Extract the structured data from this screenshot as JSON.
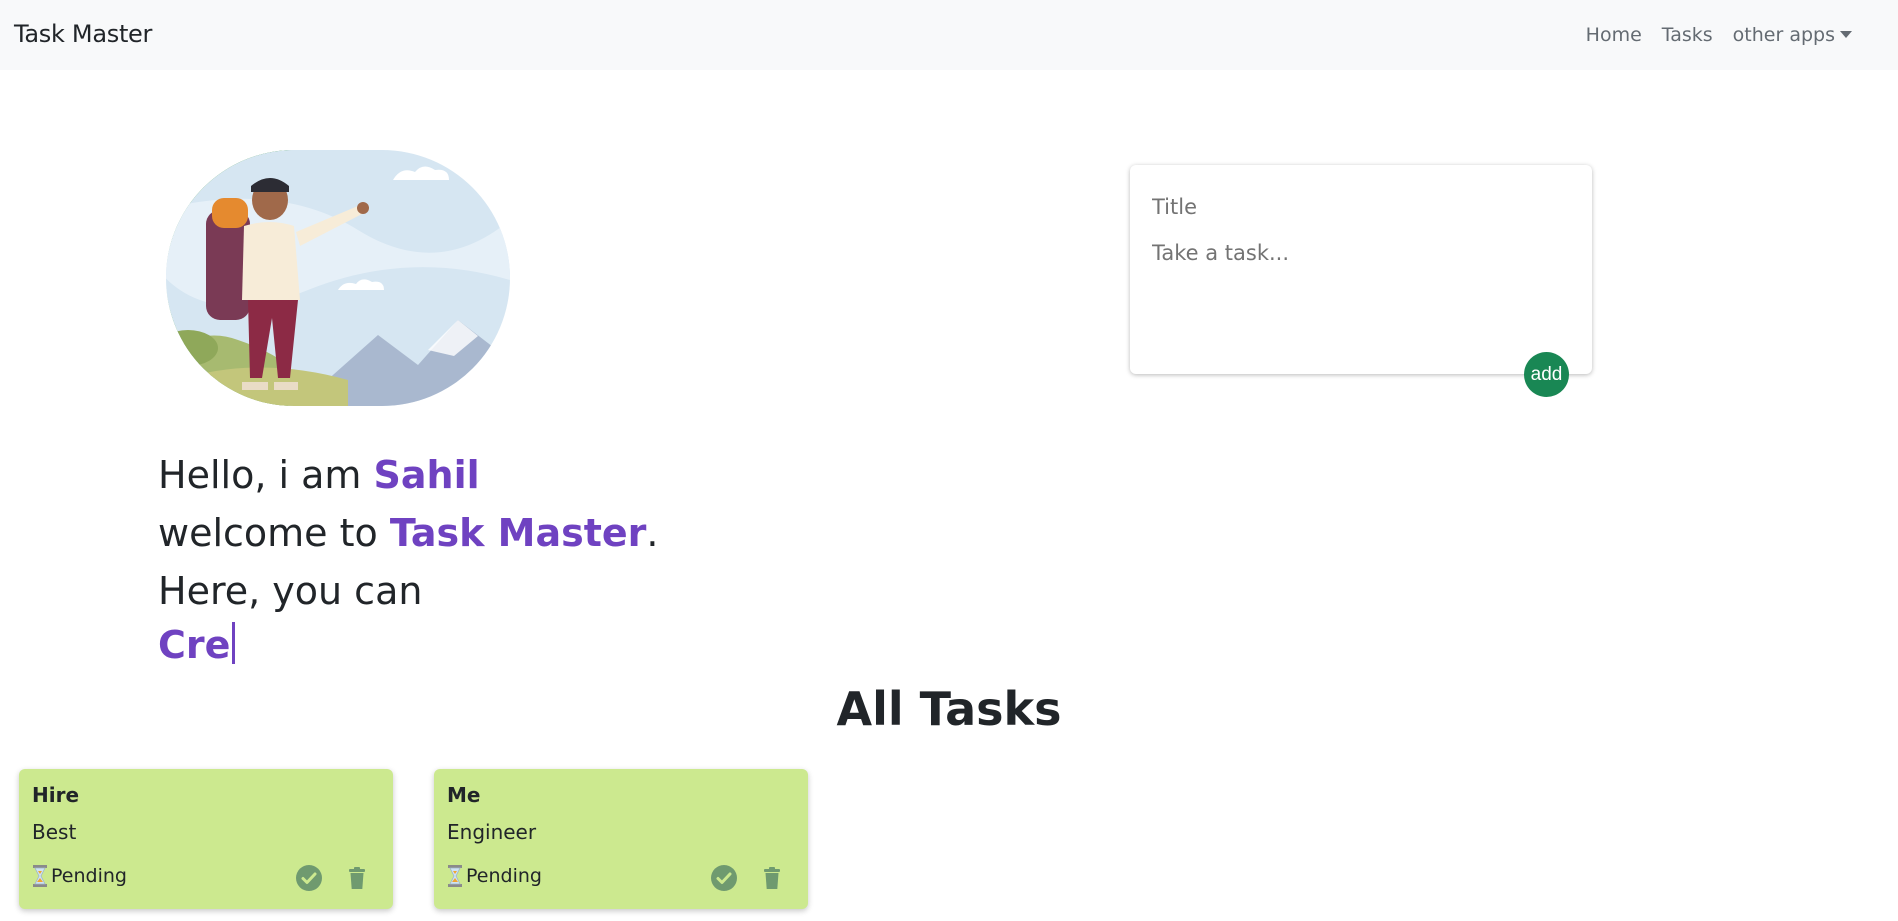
{
  "navbar": {
    "brand": "Task Master",
    "links": [
      {
        "label": "Home"
      },
      {
        "label": "Tasks"
      },
      {
        "label": "other apps"
      }
    ]
  },
  "hero": {
    "line1_prefix": "Hello, i am ",
    "name": "Sahil",
    "line2_prefix": "welcome to ",
    "app_name": "Task Master",
    "line2_suffix": ".",
    "line3": "Here, you can",
    "typed_text": "Cre"
  },
  "task_form": {
    "title_placeholder": "Title",
    "task_placeholder": "Take a task...",
    "add_label": "add"
  },
  "tasks_section": {
    "heading": "All Tasks",
    "tasks": [
      {
        "title": "Hire",
        "description": "Best",
        "status": "Pending"
      },
      {
        "title": "Me",
        "description": "Engineer",
        "status": "Pending"
      }
    ]
  },
  "colors": {
    "accent": "#6f42c1",
    "card_bg": "#cce98f",
    "add_button": "#198754",
    "icon": "#6f9a6f",
    "navbar_bg": "#f8f9fa"
  }
}
